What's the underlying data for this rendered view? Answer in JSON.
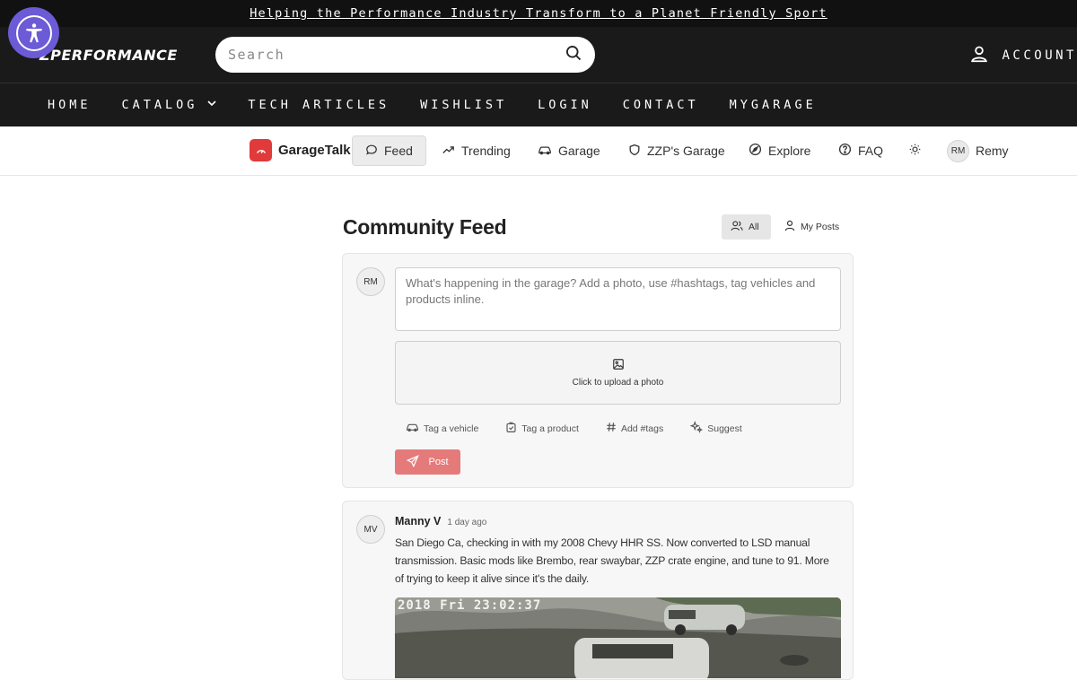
{
  "announcement": {
    "text": "Helping the Performance Industry Transform to a Planet Friendly Sport"
  },
  "header": {
    "logo_text": "ZPERFORMANCE",
    "search_placeholder": "Search",
    "account_label": "ACCOUNT"
  },
  "nav": {
    "items": [
      {
        "label": "HOME"
      },
      {
        "label": "CATALOG",
        "has_dropdown": true
      },
      {
        "label": "TECH ARTICLES"
      },
      {
        "label": "WISHLIST"
      },
      {
        "label": "LOGIN"
      },
      {
        "label": "CONTACT"
      },
      {
        "label": "MYGARAGE"
      }
    ]
  },
  "garagetalk": {
    "brand": "GarageTalk",
    "tabs": [
      {
        "label": "Feed",
        "icon": "chat-bubble-icon",
        "active": true
      },
      {
        "label": "Trending",
        "icon": "trending-icon"
      },
      {
        "label": "Garage",
        "icon": "car-icon"
      },
      {
        "label": "ZZP's Garage",
        "icon": "shield-icon"
      },
      {
        "label": "Explore",
        "icon": "compass-icon"
      },
      {
        "label": "FAQ",
        "icon": "help-circle-icon"
      }
    ],
    "user": {
      "initials": "RM",
      "name": "Remy"
    }
  },
  "feed": {
    "title": "Community Feed",
    "filters": [
      {
        "label": "All",
        "active": true
      },
      {
        "label": "My Posts",
        "active": false
      }
    ],
    "composer": {
      "avatar_initials": "RM",
      "placeholder": "What's happening in the garage? Add a photo, use #hashtags, tag vehicles and products inline.",
      "upload_label": "Click to upload a photo",
      "tools": [
        {
          "label": "Tag a vehicle",
          "icon": "car-icon"
        },
        {
          "label": "Tag a product",
          "icon": "tag-icon"
        },
        {
          "label": "Add #tags",
          "icon": "hash-icon"
        },
        {
          "label": "Suggest",
          "icon": "sparkle-icon"
        }
      ],
      "post_label": "Post",
      "post_color": "#e57a7a"
    },
    "posts": [
      {
        "avatar_initials": "MV",
        "author": "Manny V",
        "time": "1 day ago",
        "body": "San Diego Ca, checking in with my 2008 Chevy HHR SS. Now converted to LSD manual transmission. Basic mods like Brembo, rear swaybar, ZZP crate engine, and tune to 91. More of trying to keep it alive since it's the daily.",
        "image_stamp": "2018 Fri 23:02:37"
      }
    ]
  },
  "colors": {
    "brand_red": "#e03a3a",
    "header_bg": "#1a1a1a",
    "a11y_purple": "#6b5bd6"
  }
}
